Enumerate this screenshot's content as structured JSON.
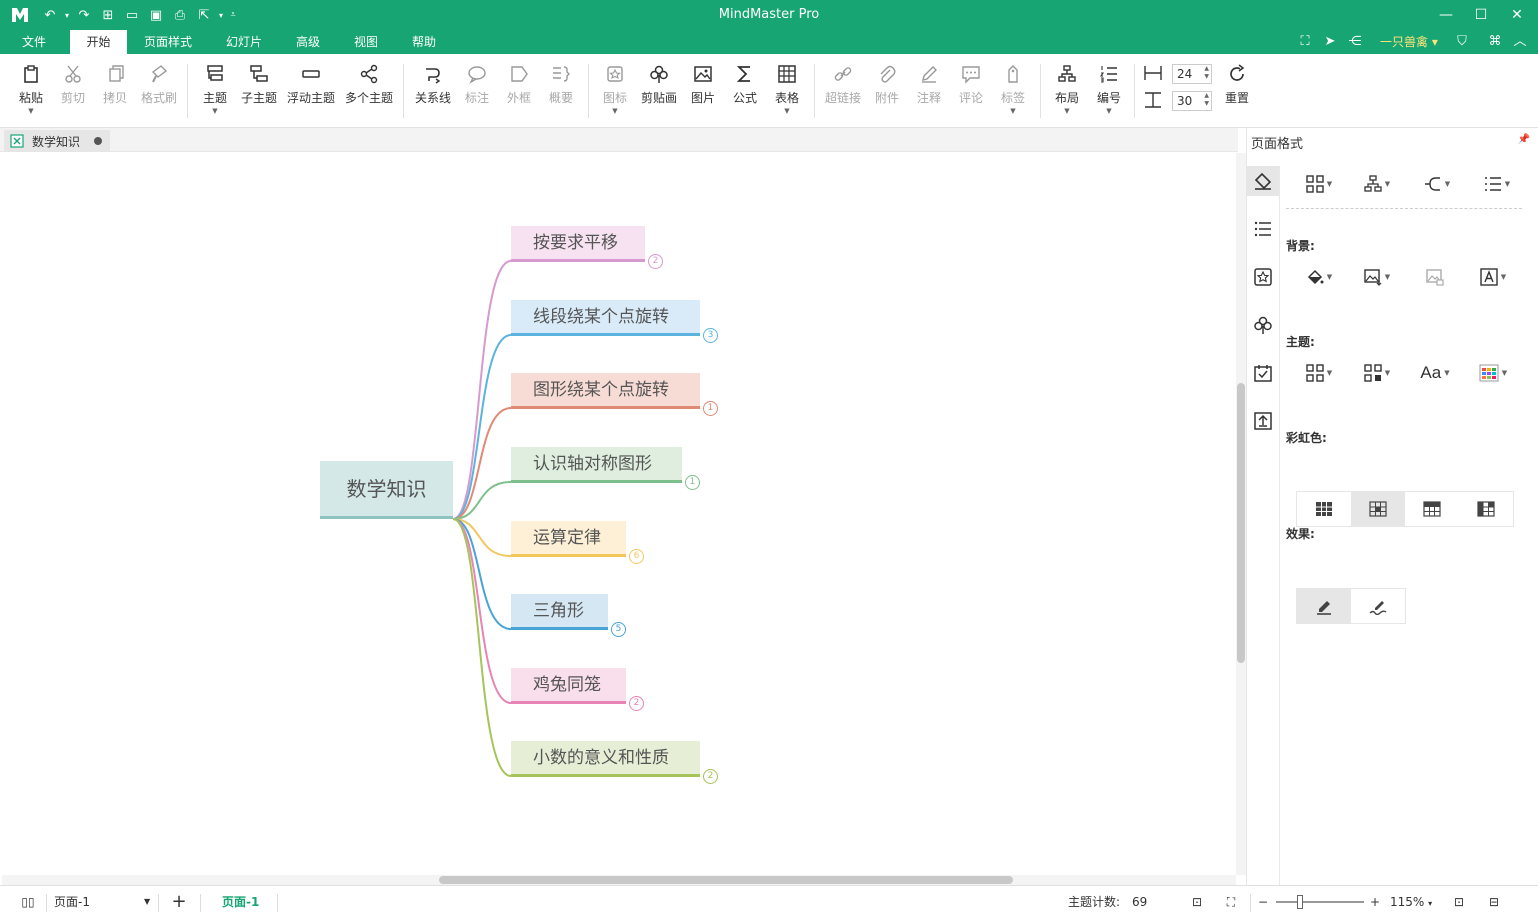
{
  "app": {
    "title": "MindMaster Pro",
    "user": "一只兽禽"
  },
  "menu": {
    "tabs": [
      "文件",
      "开始",
      "页面样式",
      "幻灯片",
      "高级",
      "视图",
      "帮助"
    ],
    "active": "开始"
  },
  "ribbon": {
    "paste": "粘贴",
    "cut": "剪切",
    "copy": "拷贝",
    "format_painter": "格式刷",
    "topic": "主题",
    "subtopic": "子主题",
    "floating_topic": "浮动主题",
    "multiple_topics": "多个主题",
    "relationship": "关系线",
    "callout": "标注",
    "boundary": "外框",
    "summary": "概要",
    "icon": "图标",
    "clipart": "剪贴画",
    "picture": "图片",
    "formula": "公式",
    "table": "表格",
    "hyperlink": "超链接",
    "attachment": "附件",
    "note": "注释",
    "comment": "评论",
    "tag": "标签",
    "layout": "布局",
    "numbering": "编号",
    "spacing_h": "24",
    "spacing_v": "30",
    "reset": "重置"
  },
  "document": {
    "tab_name": "数学知识"
  },
  "mindmap": {
    "root": "数学知识",
    "topics": [
      {
        "label": "按要求平移",
        "count": "2",
        "color": "#d79ad0",
        "bg": "#f7e2f1"
      },
      {
        "label": "线段绕某个点旋转",
        "count": "3",
        "color": "#5cb3de",
        "bg": "#d9ebf8"
      },
      {
        "label": "图形绕某个点旋转",
        "count": "1",
        "color": "#e08a74",
        "bg": "#f6dcd4"
      },
      {
        "label": "认识轴对称图形",
        "count": "1",
        "color": "#7ec08c",
        "bg": "#dfeedf"
      },
      {
        "label": "运算定律",
        "count": "6",
        "color": "#f2c85d",
        "bg": "#fdf0d6"
      },
      {
        "label": "三角形",
        "count": "5",
        "color": "#4aa3d6",
        "bg": "#d6e7f4"
      },
      {
        "label": "鸡兔同笼",
        "count": "2",
        "color": "#e883b6",
        "bg": "#f9deeb"
      },
      {
        "label": "小数的意义和性质",
        "count": "2",
        "color": "#a5c45c",
        "bg": "#e6eed6"
      }
    ]
  },
  "panel": {
    "title": "页面格式",
    "background_label": "背景:",
    "theme_label": "主题:",
    "rainbow_label": "彩虹色:",
    "effects_label": "效果:"
  },
  "status": {
    "page_select": "页面-1",
    "page_tab": "页面-1",
    "topic_count_label": "主题计数:",
    "topic_count": "69",
    "zoom": "115%"
  }
}
